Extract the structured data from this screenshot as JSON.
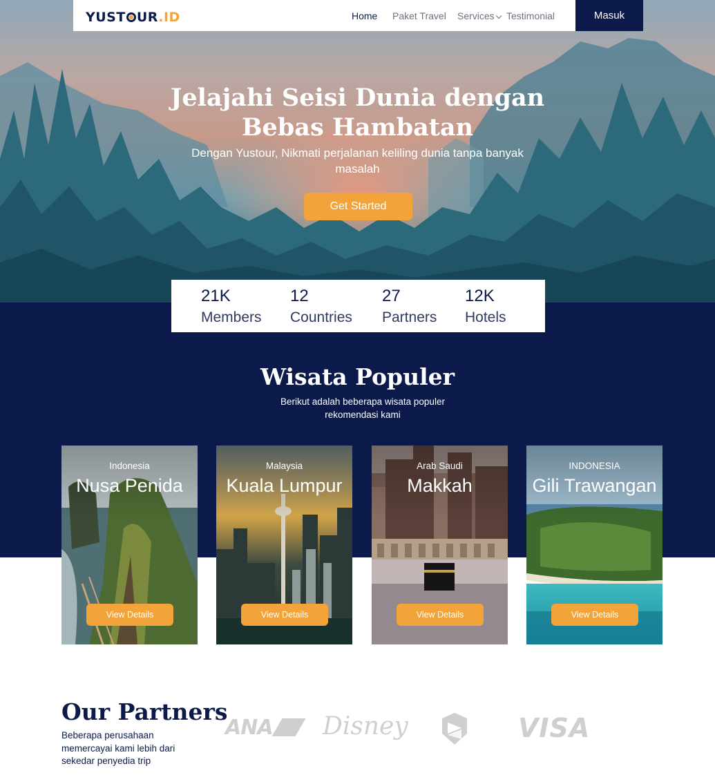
{
  "navbar": {
    "logo_main": "YUST",
    "logo_after_o": "UR",
    "logo_accent": ".ID",
    "links": [
      {
        "label": "Home",
        "active": true
      },
      {
        "label": "Paket Travel",
        "active": false
      },
      {
        "label": "Services",
        "active": false,
        "has_dropdown": true,
        "icon": "chevron-down-icon"
      },
      {
        "label": "Testimonial",
        "active": false
      }
    ],
    "login_label": "Masuk"
  },
  "hero": {
    "title": "Jelajahi Seisi Dunia dengan Bebas Hambatan",
    "subtitle": "Dengan Yustour, Nikmati perjalanan keliling dunia tanpa banyak masalah",
    "cta_label": "Get Started"
  },
  "stats": [
    {
      "value": "21K",
      "label": "Members"
    },
    {
      "value": "12",
      "label": "Countries"
    },
    {
      "value": "27",
      "label": "Partners"
    },
    {
      "value": "12K",
      "label": "Hotels"
    }
  ],
  "popular": {
    "title": "Wisata Populer",
    "subtitle": "Berikut adalah beberapa wisata populer rekomendasi kami",
    "cards": [
      {
        "country": "Indonesia",
        "city": "Nusa Penida",
        "button": "View Details"
      },
      {
        "country": "Malaysia",
        "city": "Kuala Lumpur",
        "button": "View Details"
      },
      {
        "country": "Arab Saudi",
        "city": "Makkah",
        "button": "View Details"
      },
      {
        "country": "INDONESIA",
        "city": "Gili Trawangan",
        "button": "View Details"
      }
    ]
  },
  "partners": {
    "title": "Our Partners",
    "subtitle": "Beberapa perusahaan memercayai kami lebih dari sekedar penyedia trip",
    "logos": [
      {
        "name": "ANA",
        "icon": "ana-logo"
      },
      {
        "name": "Disney",
        "icon": "disney-logo"
      },
      {
        "name": "shield",
        "icon": "shield-logo"
      },
      {
        "name": "VISA",
        "icon": "visa-logo"
      }
    ]
  },
  "colors": {
    "navy": "#0b1a4a",
    "accent": "#f2a43a",
    "logo_gray": "#cfcfcf"
  }
}
